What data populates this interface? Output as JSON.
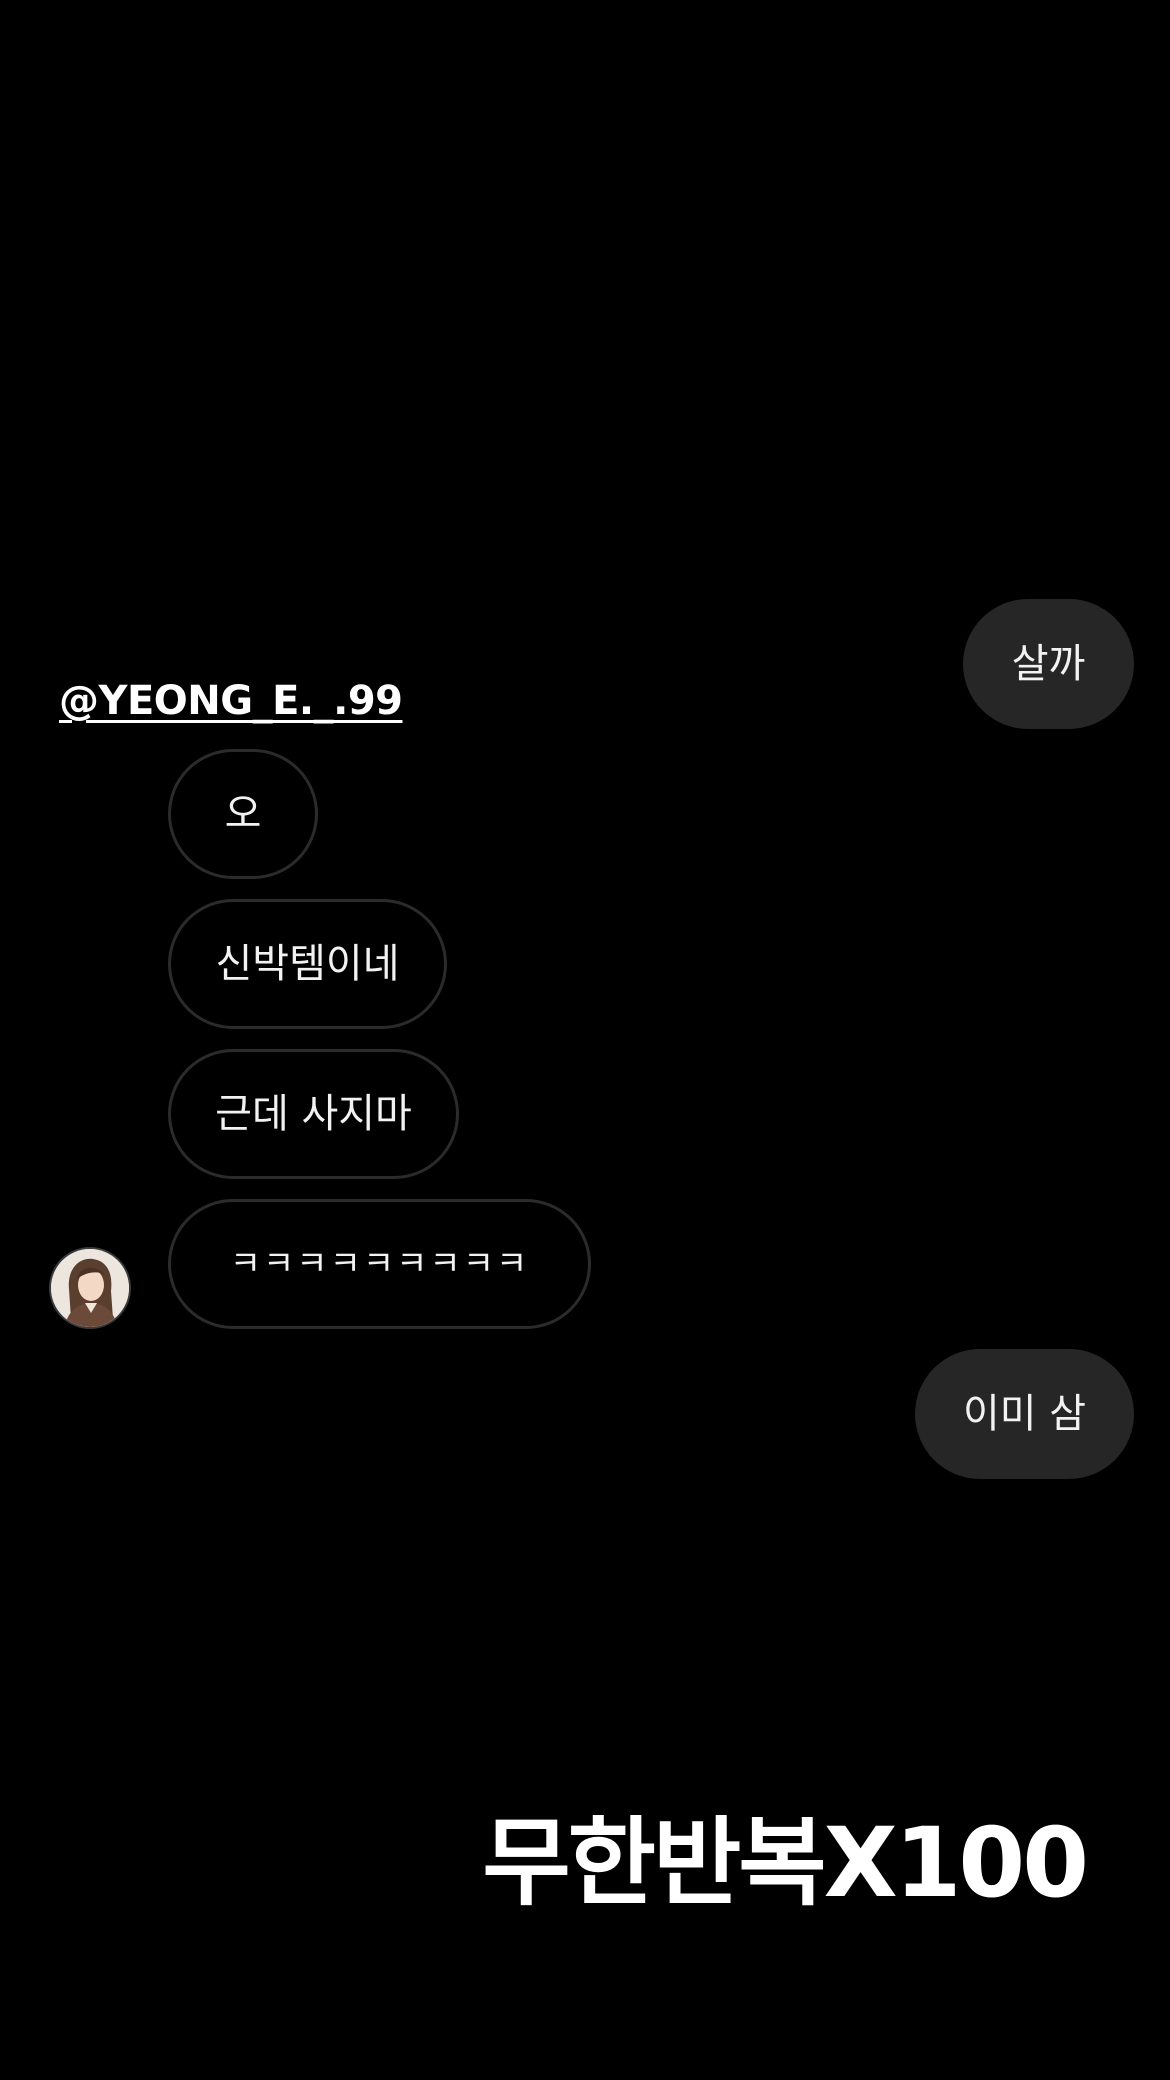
{
  "chat": {
    "username": "@YEONG_E._.99",
    "messages": [
      {
        "sender": "me",
        "text": "살까"
      },
      {
        "sender": "them",
        "text": "오"
      },
      {
        "sender": "them",
        "text": "신박템이네"
      },
      {
        "sender": "them",
        "text": "근데 사지마"
      },
      {
        "sender": "them",
        "text": "ㅋㅋㅋㅋㅋㅋㅋㅋㅋ"
      },
      {
        "sender": "me",
        "text": "이미 삼"
      }
    ],
    "avatar_icon": "profile-photo-avatar"
  },
  "overlay": {
    "caption": "무한반복X100"
  },
  "colors": {
    "background": "#000000",
    "outgoing_bubble": "#262626",
    "incoming_border": "#2b2b2b",
    "text": "#ffffff"
  }
}
